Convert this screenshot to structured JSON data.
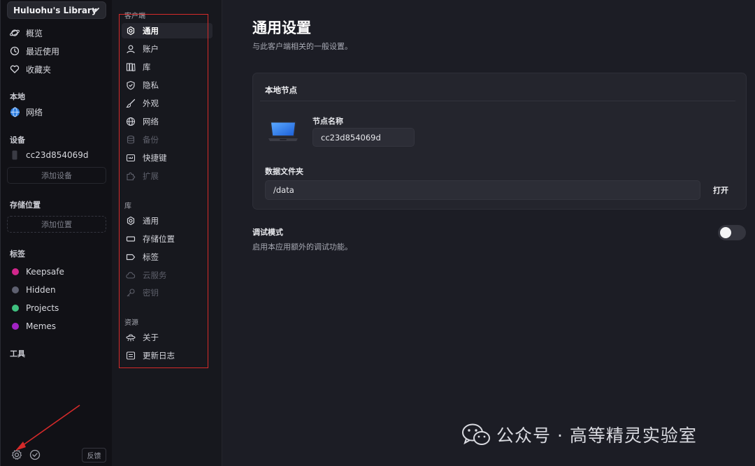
{
  "sidebar": {
    "library_name": "Huluohu's Library",
    "items": [
      {
        "label": "概览",
        "icon": "planet-icon"
      },
      {
        "label": "最近使用",
        "icon": "clock-icon"
      },
      {
        "label": "收藏夹",
        "icon": "heart-icon"
      }
    ],
    "local": {
      "heading": "本地",
      "item": "网络"
    },
    "devices": {
      "heading": "设备",
      "device": "cc23d854069d",
      "add_label": "添加设备"
    },
    "locations": {
      "heading": "存储位置",
      "add_label": "添加位置"
    },
    "tags": {
      "heading": "标签",
      "items": [
        {
          "label": "Keepsafe",
          "color": "#d1268b"
        },
        {
          "label": "Hidden",
          "color": "#5e6070"
        },
        {
          "label": "Projects",
          "color": "#3fc07f"
        },
        {
          "label": "Memes",
          "color": "#a223c4"
        }
      ]
    },
    "tools": {
      "heading": "工具"
    },
    "footer": {
      "feedback_label": "反馈"
    }
  },
  "settings_nav": {
    "client": {
      "heading": "客户端",
      "items": [
        {
          "label": "通用",
          "icon": "gear-icon",
          "state": "active"
        },
        {
          "label": "账户",
          "icon": "user-icon",
          "state": "normal"
        },
        {
          "label": "库",
          "icon": "books-icon",
          "state": "normal"
        },
        {
          "label": "隐私",
          "icon": "shield-icon",
          "state": "normal"
        },
        {
          "label": "外观",
          "icon": "brush-icon",
          "state": "normal"
        },
        {
          "label": "网络",
          "icon": "globe-icon",
          "state": "normal"
        },
        {
          "label": "备份",
          "icon": "database-icon",
          "state": "disabled"
        },
        {
          "label": "快捷键",
          "icon": "keyboard-icon",
          "state": "normal"
        },
        {
          "label": "扩展",
          "icon": "puzzle-icon",
          "state": "disabled"
        }
      ]
    },
    "library": {
      "heading": "库",
      "items": [
        {
          "label": "通用",
          "icon": "gear-icon",
          "state": "normal"
        },
        {
          "label": "存储位置",
          "icon": "drive-icon",
          "state": "normal"
        },
        {
          "label": "标签",
          "icon": "tag-icon",
          "state": "normal"
        },
        {
          "label": "云服务",
          "icon": "cloud-icon",
          "state": "disabled"
        },
        {
          "label": "密钥",
          "icon": "key-icon",
          "state": "disabled"
        }
      ]
    },
    "resources": {
      "heading": "资源",
      "items": [
        {
          "label": "关于",
          "icon": "ufo-icon",
          "state": "normal"
        },
        {
          "label": "更新日志",
          "icon": "changelog-icon",
          "state": "normal"
        }
      ]
    }
  },
  "main": {
    "title": "通用设置",
    "subtitle": "与此客户端相关的一般设置。",
    "node_card": {
      "title": "本地节点",
      "node_name_label": "节点名称",
      "node_name_value": "cc23d854069d",
      "data_folder_label": "数据文件夹",
      "data_folder_value": "/data",
      "open_label": "打开"
    },
    "debug": {
      "title": "调试模式",
      "desc": "启用本应用额外的调试功能。",
      "enabled": false
    }
  },
  "watermark": {
    "text": "公众号 · 高等精灵实验室"
  }
}
